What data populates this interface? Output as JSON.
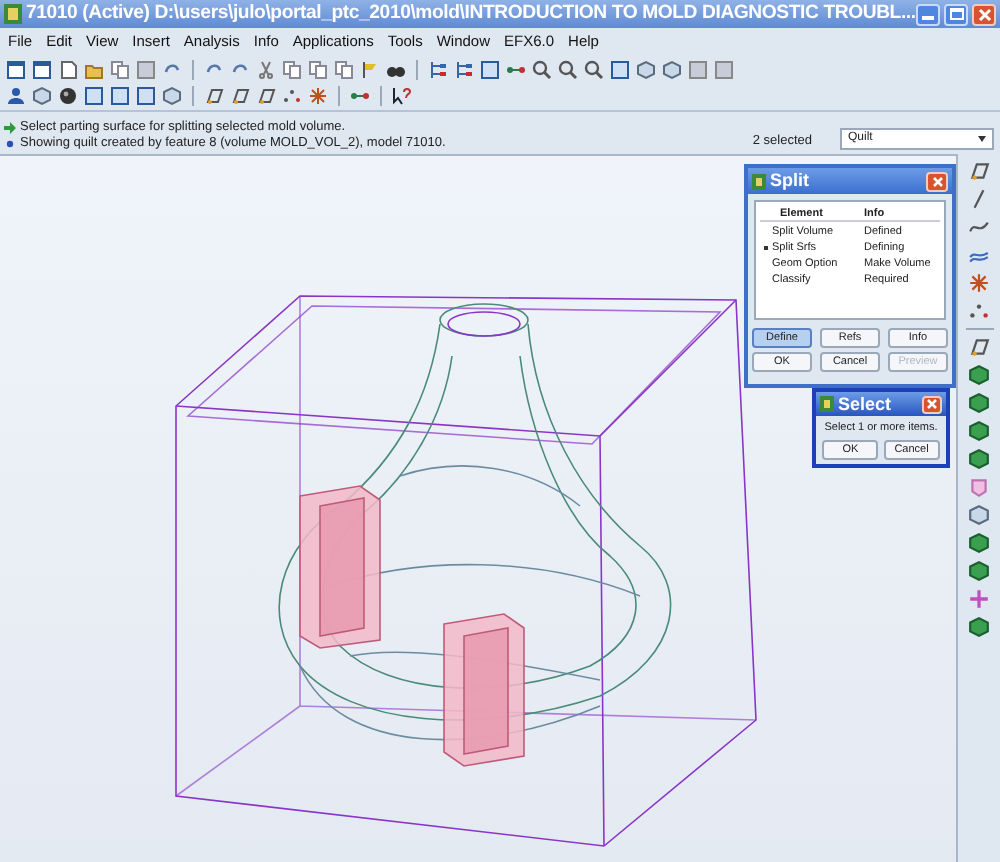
{
  "window": {
    "title": "71010 (Active) D:\\users\\julo\\portal_ptc_2010\\mold\\INTRODUCTION TO MOLD DIAGNOSTIC TROUBL..."
  },
  "menu": [
    "File",
    "Edit",
    "View",
    "Insert",
    "Analysis",
    "Info",
    "Applications",
    "Tools",
    "Window",
    "EFX6.0",
    "Help"
  ],
  "messages": [
    {
      "kind": "prompt",
      "text": "Select parting surface for splitting selected mold volume."
    },
    {
      "kind": "info",
      "text": "Showing quilt created by feature 8 (volume MOLD_VOL_2), model 71010."
    }
  ],
  "selection": {
    "count": "2 selected",
    "filter": "Quilt"
  },
  "split_dialog": {
    "title": "Split",
    "columns": [
      "Element",
      "Info"
    ],
    "rows": [
      {
        "element": "Split Volume",
        "info": "Defined",
        "current": false
      },
      {
        "element": "Split Srfs",
        "info": "Defining",
        "current": true
      },
      {
        "element": "Geom Option",
        "info": "Make Volume",
        "current": false
      },
      {
        "element": "Classify",
        "info": "Required",
        "current": false
      }
    ],
    "buttons": [
      {
        "label": "Define",
        "selected": true,
        "disabled": false
      },
      {
        "label": "Refs",
        "selected": false,
        "disabled": false
      },
      {
        "label": "Info",
        "selected": false,
        "disabled": false
      },
      {
        "label": "OK",
        "selected": false,
        "disabled": false
      },
      {
        "label": "Cancel",
        "selected": false,
        "disabled": false
      },
      {
        "label": "Preview",
        "selected": false,
        "disabled": true
      }
    ]
  },
  "select_dialog": {
    "title": "Select",
    "prompt": "Select 1 or more items.",
    "buttons": [
      "OK",
      "Cancel"
    ]
  }
}
